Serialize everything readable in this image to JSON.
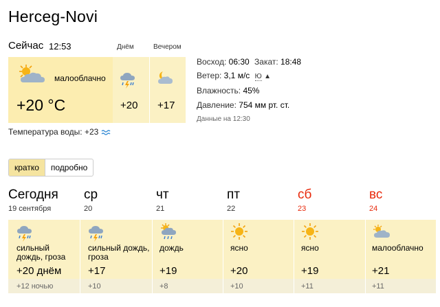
{
  "city": "Herceg-Novi",
  "now": {
    "label": "Сейчас",
    "time": "12:53",
    "condition": "малооблачно",
    "temp": "+20 °C"
  },
  "periods": [
    {
      "label": "Днём",
      "temp": "+20",
      "icon": "rain-thunder-icon"
    },
    {
      "label": "Вечером",
      "temp": "+17",
      "icon": "moon-cloud-icon"
    }
  ],
  "info": {
    "sunrise_label": "Восход:",
    "sunrise": "06:30",
    "sunset_label": "Закат:",
    "sunset": "18:48",
    "wind_label": "Ветер:",
    "wind": "3,1 м/с",
    "wind_dir": "Ю",
    "humidity_label": "Влажность:",
    "humidity": "45%",
    "pressure_label": "Давление:",
    "pressure": "754 мм рт. ст.",
    "updated": "Данные на 12:30"
  },
  "water": {
    "label": "Температура воды:",
    "value": "+23"
  },
  "tabs": [
    {
      "label": "кратко",
      "active": true
    },
    {
      "label": "подробно",
      "active": false
    }
  ],
  "days": [
    {
      "name": "Сегодня",
      "date": "19 сентября",
      "weekend": false,
      "icon": "rain-thunder-icon",
      "condition": "сильный дождь, гроза",
      "day_temp": "+20 днём",
      "night_temp": "+12 ночью"
    },
    {
      "name": "ср",
      "date": "20",
      "weekend": false,
      "icon": "rain-thunder-icon",
      "condition": "сильный дождь, гроза",
      "day_temp": "+17",
      "night_temp": "+10"
    },
    {
      "name": "чт",
      "date": "21",
      "weekend": false,
      "icon": "sun-rain-icon",
      "condition": "дождь",
      "day_temp": "+19",
      "night_temp": "+8"
    },
    {
      "name": "пт",
      "date": "22",
      "weekend": false,
      "icon": "sun-icon",
      "condition": "ясно",
      "day_temp": "+20",
      "night_temp": "+10"
    },
    {
      "name": "сб",
      "date": "23",
      "weekend": true,
      "icon": "sun-icon",
      "condition": "ясно",
      "day_temp": "+19",
      "night_temp": "+11"
    },
    {
      "name": "вс",
      "date": "24",
      "weekend": true,
      "icon": "sun-cloud-icon",
      "condition": "малооблачно",
      "day_temp": "+21",
      "night_temp": "+11"
    }
  ],
  "colors": {
    "panel": "#fbf1c4",
    "weekend": "#e8290b",
    "water_wave": "#3b8fd6"
  }
}
